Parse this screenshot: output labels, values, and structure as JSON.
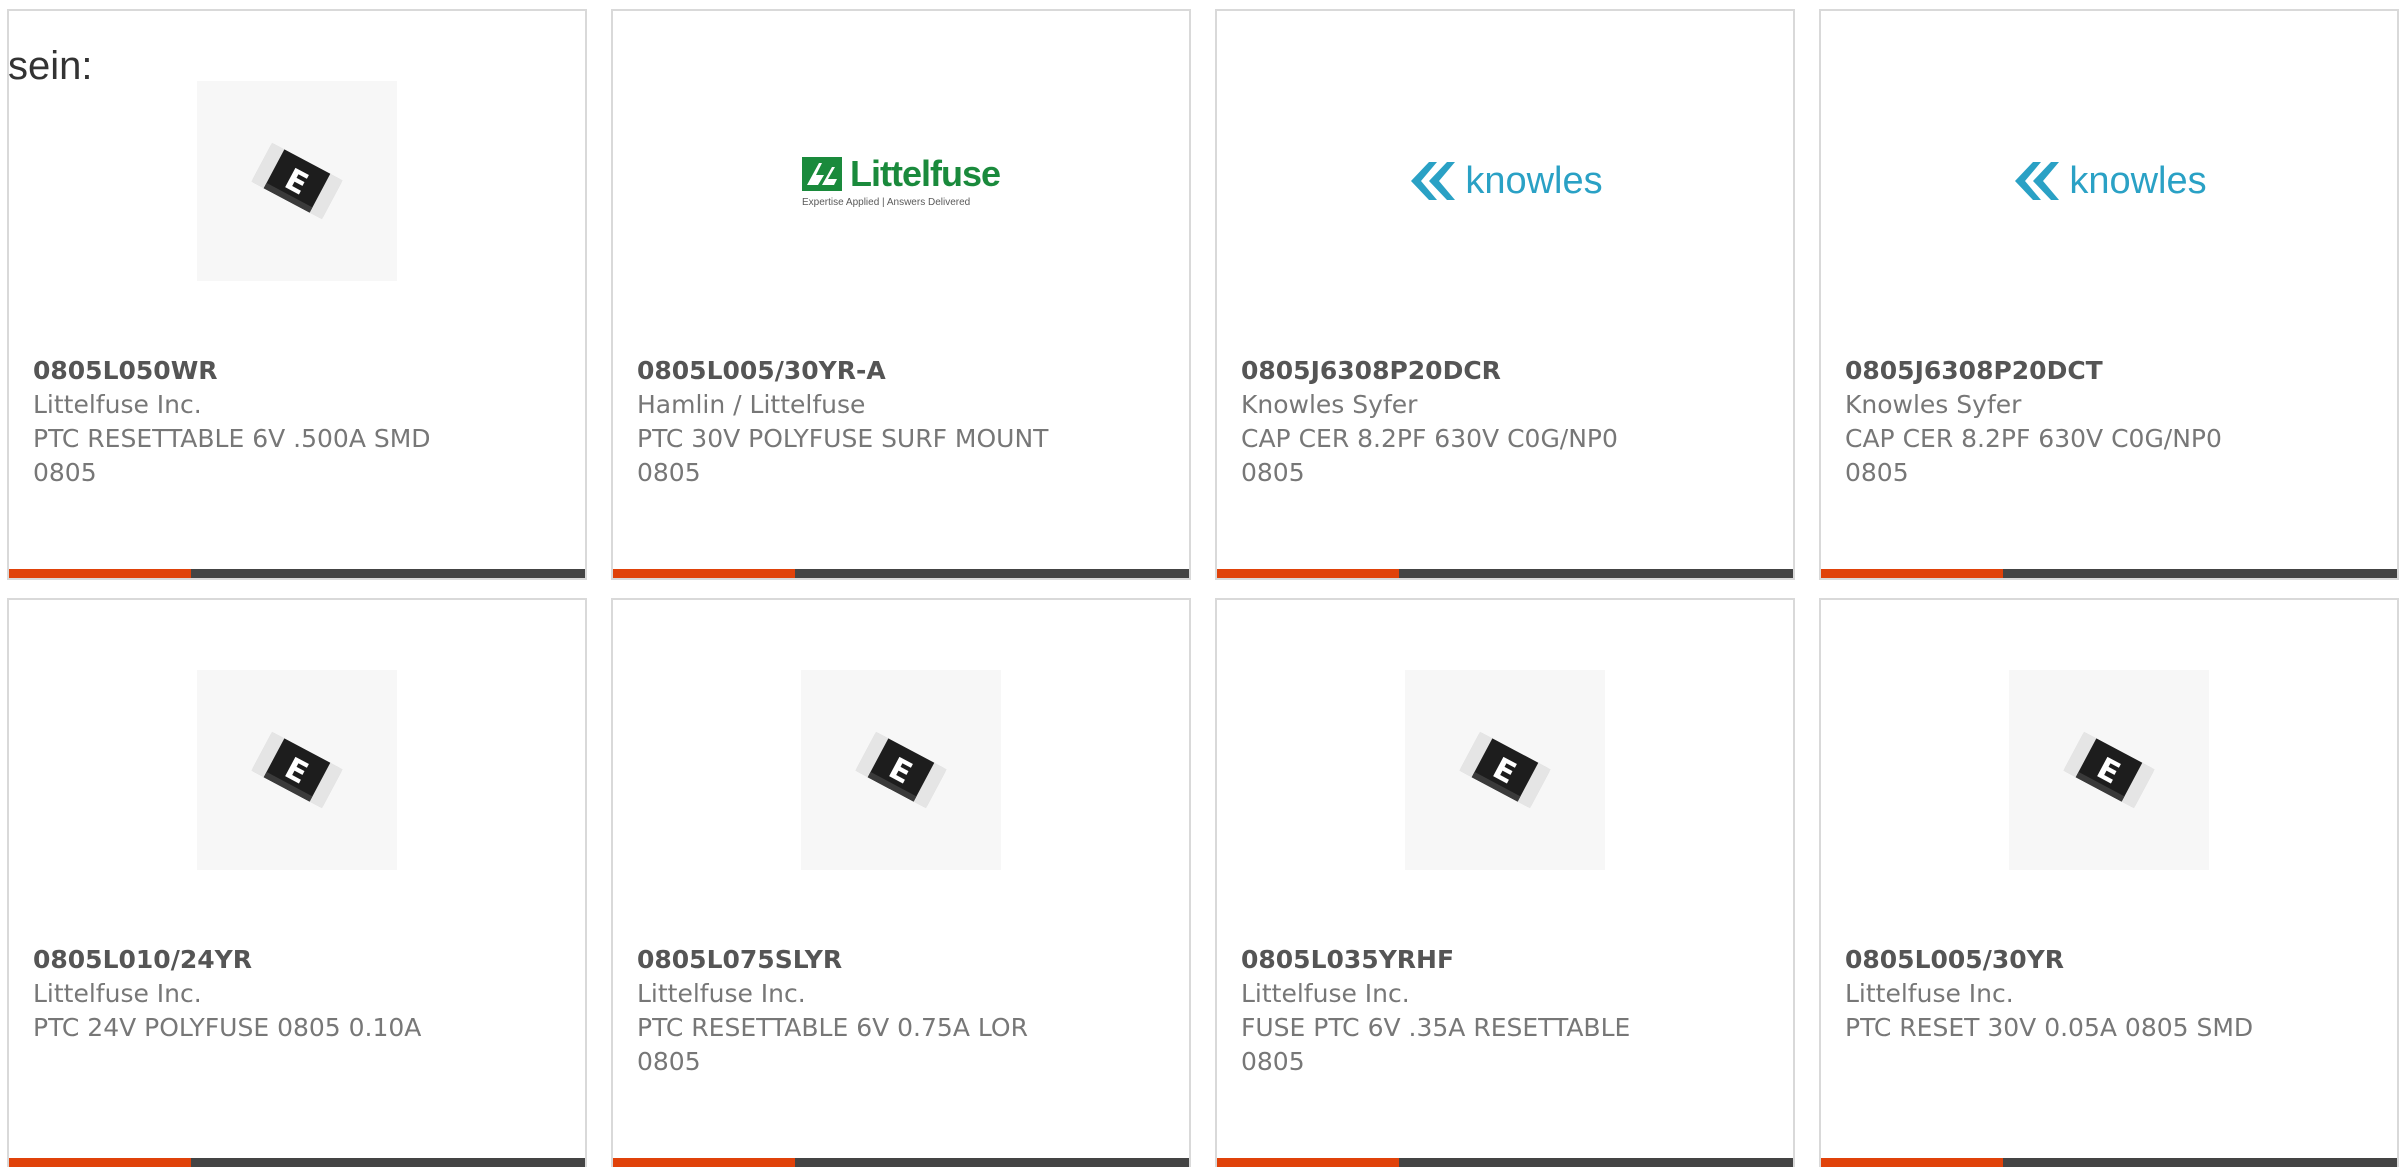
{
  "intro_text": "sein:",
  "colors": {
    "accent": "#e0420a",
    "bar_dark": "#444444",
    "littelfuse_green": "#1a8a3c",
    "knowles_blue": "#2aa1c5"
  },
  "progress_fraction": 0.316,
  "products": [
    {
      "image": "ptc-fuse-chip-icon",
      "part_number": "0805L050WR",
      "manufacturer": "Littelfuse Inc.",
      "description": "PTC RESETTABLE 6V .500A SMD 0805"
    },
    {
      "image": "littelfuse-logo",
      "logo_text": "Littelfuse",
      "logo_tagline": "Expertise Applied | Answers Delivered",
      "part_number": "0805L005/30YR-A",
      "manufacturer": "Hamlin / Littelfuse",
      "description": "PTC 30V POLYFUSE SURF MOUNT 0805"
    },
    {
      "image": "knowles-logo",
      "logo_text": "knowles",
      "part_number": "0805J6308P20DCR",
      "manufacturer": "Knowles Syfer",
      "description": "CAP CER 8.2PF 630V C0G/NP0 0805"
    },
    {
      "image": "knowles-logo",
      "logo_text": "knowles",
      "part_number": "0805J6308P20DCT",
      "manufacturer": "Knowles Syfer",
      "description": "CAP CER 8.2PF 630V C0G/NP0 0805"
    },
    {
      "image": "ptc-fuse-chip-icon",
      "part_number": "0805L010/24YR",
      "manufacturer": "Littelfuse Inc.",
      "description": "PTC 24V POLYFUSE 0805 0.10A"
    },
    {
      "image": "ptc-fuse-chip-icon",
      "part_number": "0805L075SLYR",
      "manufacturer": "Littelfuse Inc.",
      "description": "PTC RESETTABLE 6V 0.75A LOR 0805"
    },
    {
      "image": "ptc-fuse-chip-icon",
      "part_number": "0805L035YRHF",
      "manufacturer": "Littelfuse Inc.",
      "description": "FUSE PTC 6V .35A RESETTABLE 0805"
    },
    {
      "image": "ptc-fuse-chip-icon",
      "part_number": "0805L005/30YR",
      "manufacturer": "Littelfuse Inc.",
      "description": "PTC RESET 30V 0.05A 0805 SMD"
    }
  ]
}
